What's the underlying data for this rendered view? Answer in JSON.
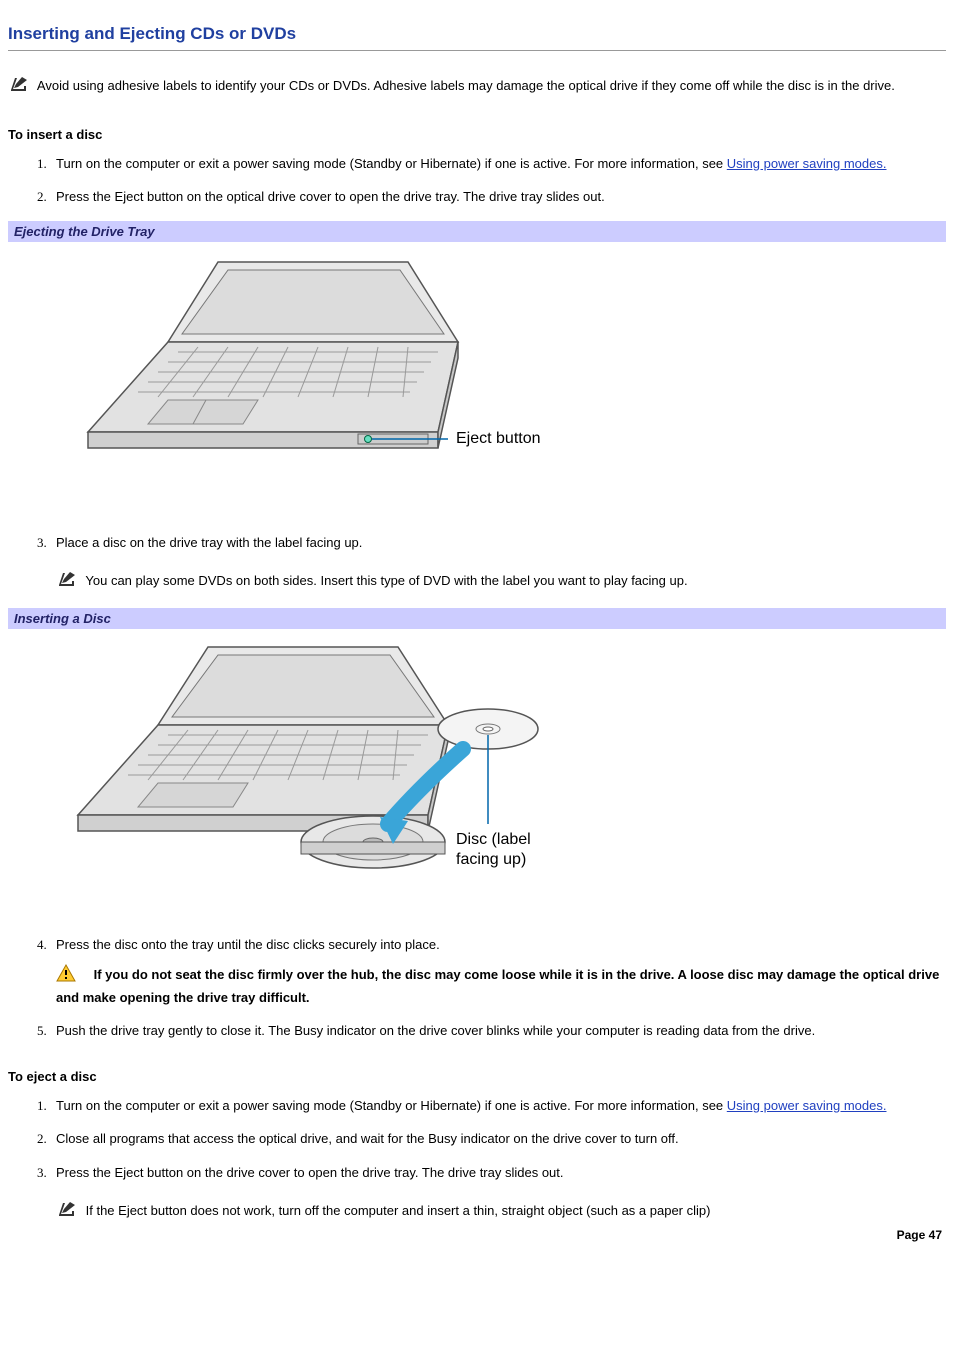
{
  "heading": "Inserting and Ejecting CDs or DVDs",
  "intro_note": "Avoid using adhesive labels to identify your CDs or DVDs. Adhesive labels may damage the optical drive if they come off while the disc is in the drive.",
  "insert": {
    "title": "To insert a disc",
    "step1_a": "Turn on the computer or exit a power saving mode (Standby or Hibernate) if one is active. For more information, see ",
    "step1_link": "Using power saving modes.",
    "step2": "Press the Eject button on the optical drive cover to open the drive tray. The drive tray slides out.",
    "fig1_caption": "Ejecting the Drive Tray",
    "fig1_label": "Eject button",
    "step3": "Place a disc on the drive tray with the label facing up.",
    "step3_note": "You can play some DVDs on both sides. Insert this type of DVD with the label you want to play facing up.",
    "fig2_caption": "Inserting a Disc",
    "fig2_label_a": "Disc (label",
    "fig2_label_b": "facing up)",
    "step4": "Press the disc onto the tray until the disc clicks securely into place.",
    "step4_warn": "If you do not seat the disc firmly over the hub, the disc may come loose while it is in the drive. A loose disc may damage the optical drive and make opening the drive tray difficult.",
    "step5": "Push the drive tray gently to close it. The Busy indicator on the drive cover blinks while your computer is reading data from the drive."
  },
  "eject": {
    "title": "To eject a disc",
    "step1_a": "Turn on the computer or exit a power saving mode (Standby or Hibernate) if one is active. For more information, see ",
    "step1_link": "Using power saving modes.",
    "step2": "Close all programs that access the optical drive, and wait for the Busy indicator on the drive cover to turn off.",
    "step3": "Press the Eject button on the drive cover to open the drive tray. The drive tray slides out.",
    "step3_note": "If the Eject button does not work, turn off the computer and insert a thin, straight object (such as a paper clip)"
  },
  "page_number": "Page 47"
}
